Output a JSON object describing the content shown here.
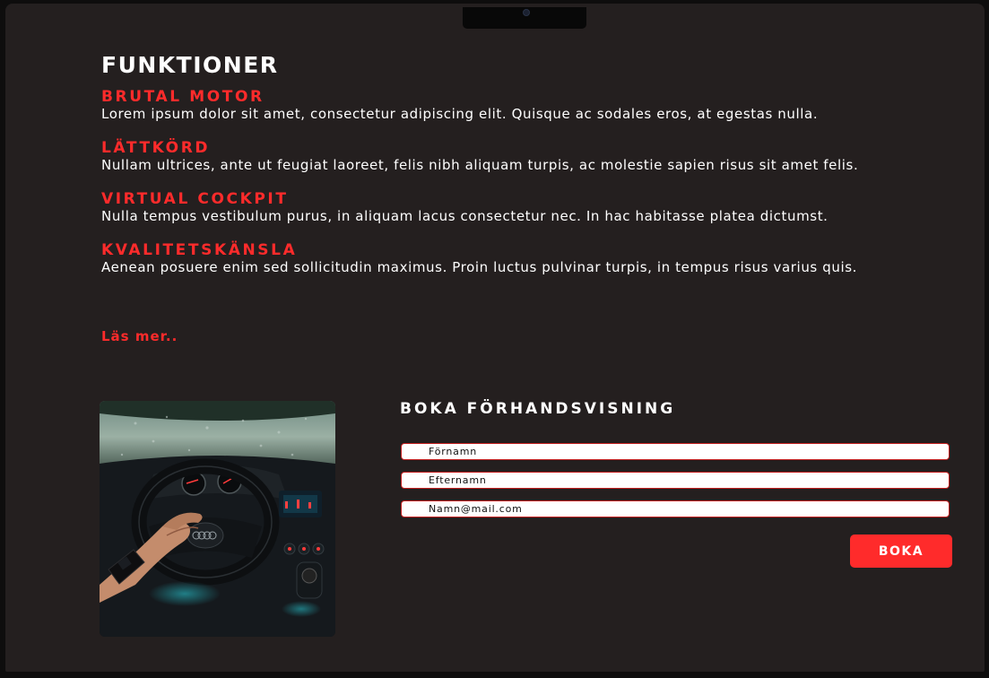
{
  "features_section": {
    "heading": "FUNKTIONER",
    "items": [
      {
        "title": "BRUTAL MOTOR",
        "text": "Lorem ipsum dolor sit amet, consectetur adipiscing elit. Quisque ac sodales eros, at egestas nulla."
      },
      {
        "title": "LÄTTKÖRD",
        "text": "Nullam ultrices, ante ut feugiat laoreet, felis nibh aliquam turpis, ac molestie sapien risus sit amet felis."
      },
      {
        "title": "VIRTUAL COCKPIT",
        "text": "Nulla tempus vestibulum purus, in aliquam lacus consectetur nec. In hac habitasse platea dictumst."
      },
      {
        "title": "KVALITETSKÄNSLA",
        "text": "Aenean posuere enim sed sollicitudin maximus. Proin luctus pulvinar turpis, in tempus risus varius quis."
      }
    ],
    "read_more": "Läs mer.."
  },
  "booking_form": {
    "title": "BOKA FÖRHANDSVISNING",
    "first_name_placeholder": "Förnamn",
    "last_name_placeholder": "Efternamn",
    "email_placeholder": "Namn@mail.com",
    "submit_label": "BOKA"
  },
  "colors": {
    "background": "#241f1f",
    "accent": "#ff2b2b",
    "text": "#ffffff"
  }
}
